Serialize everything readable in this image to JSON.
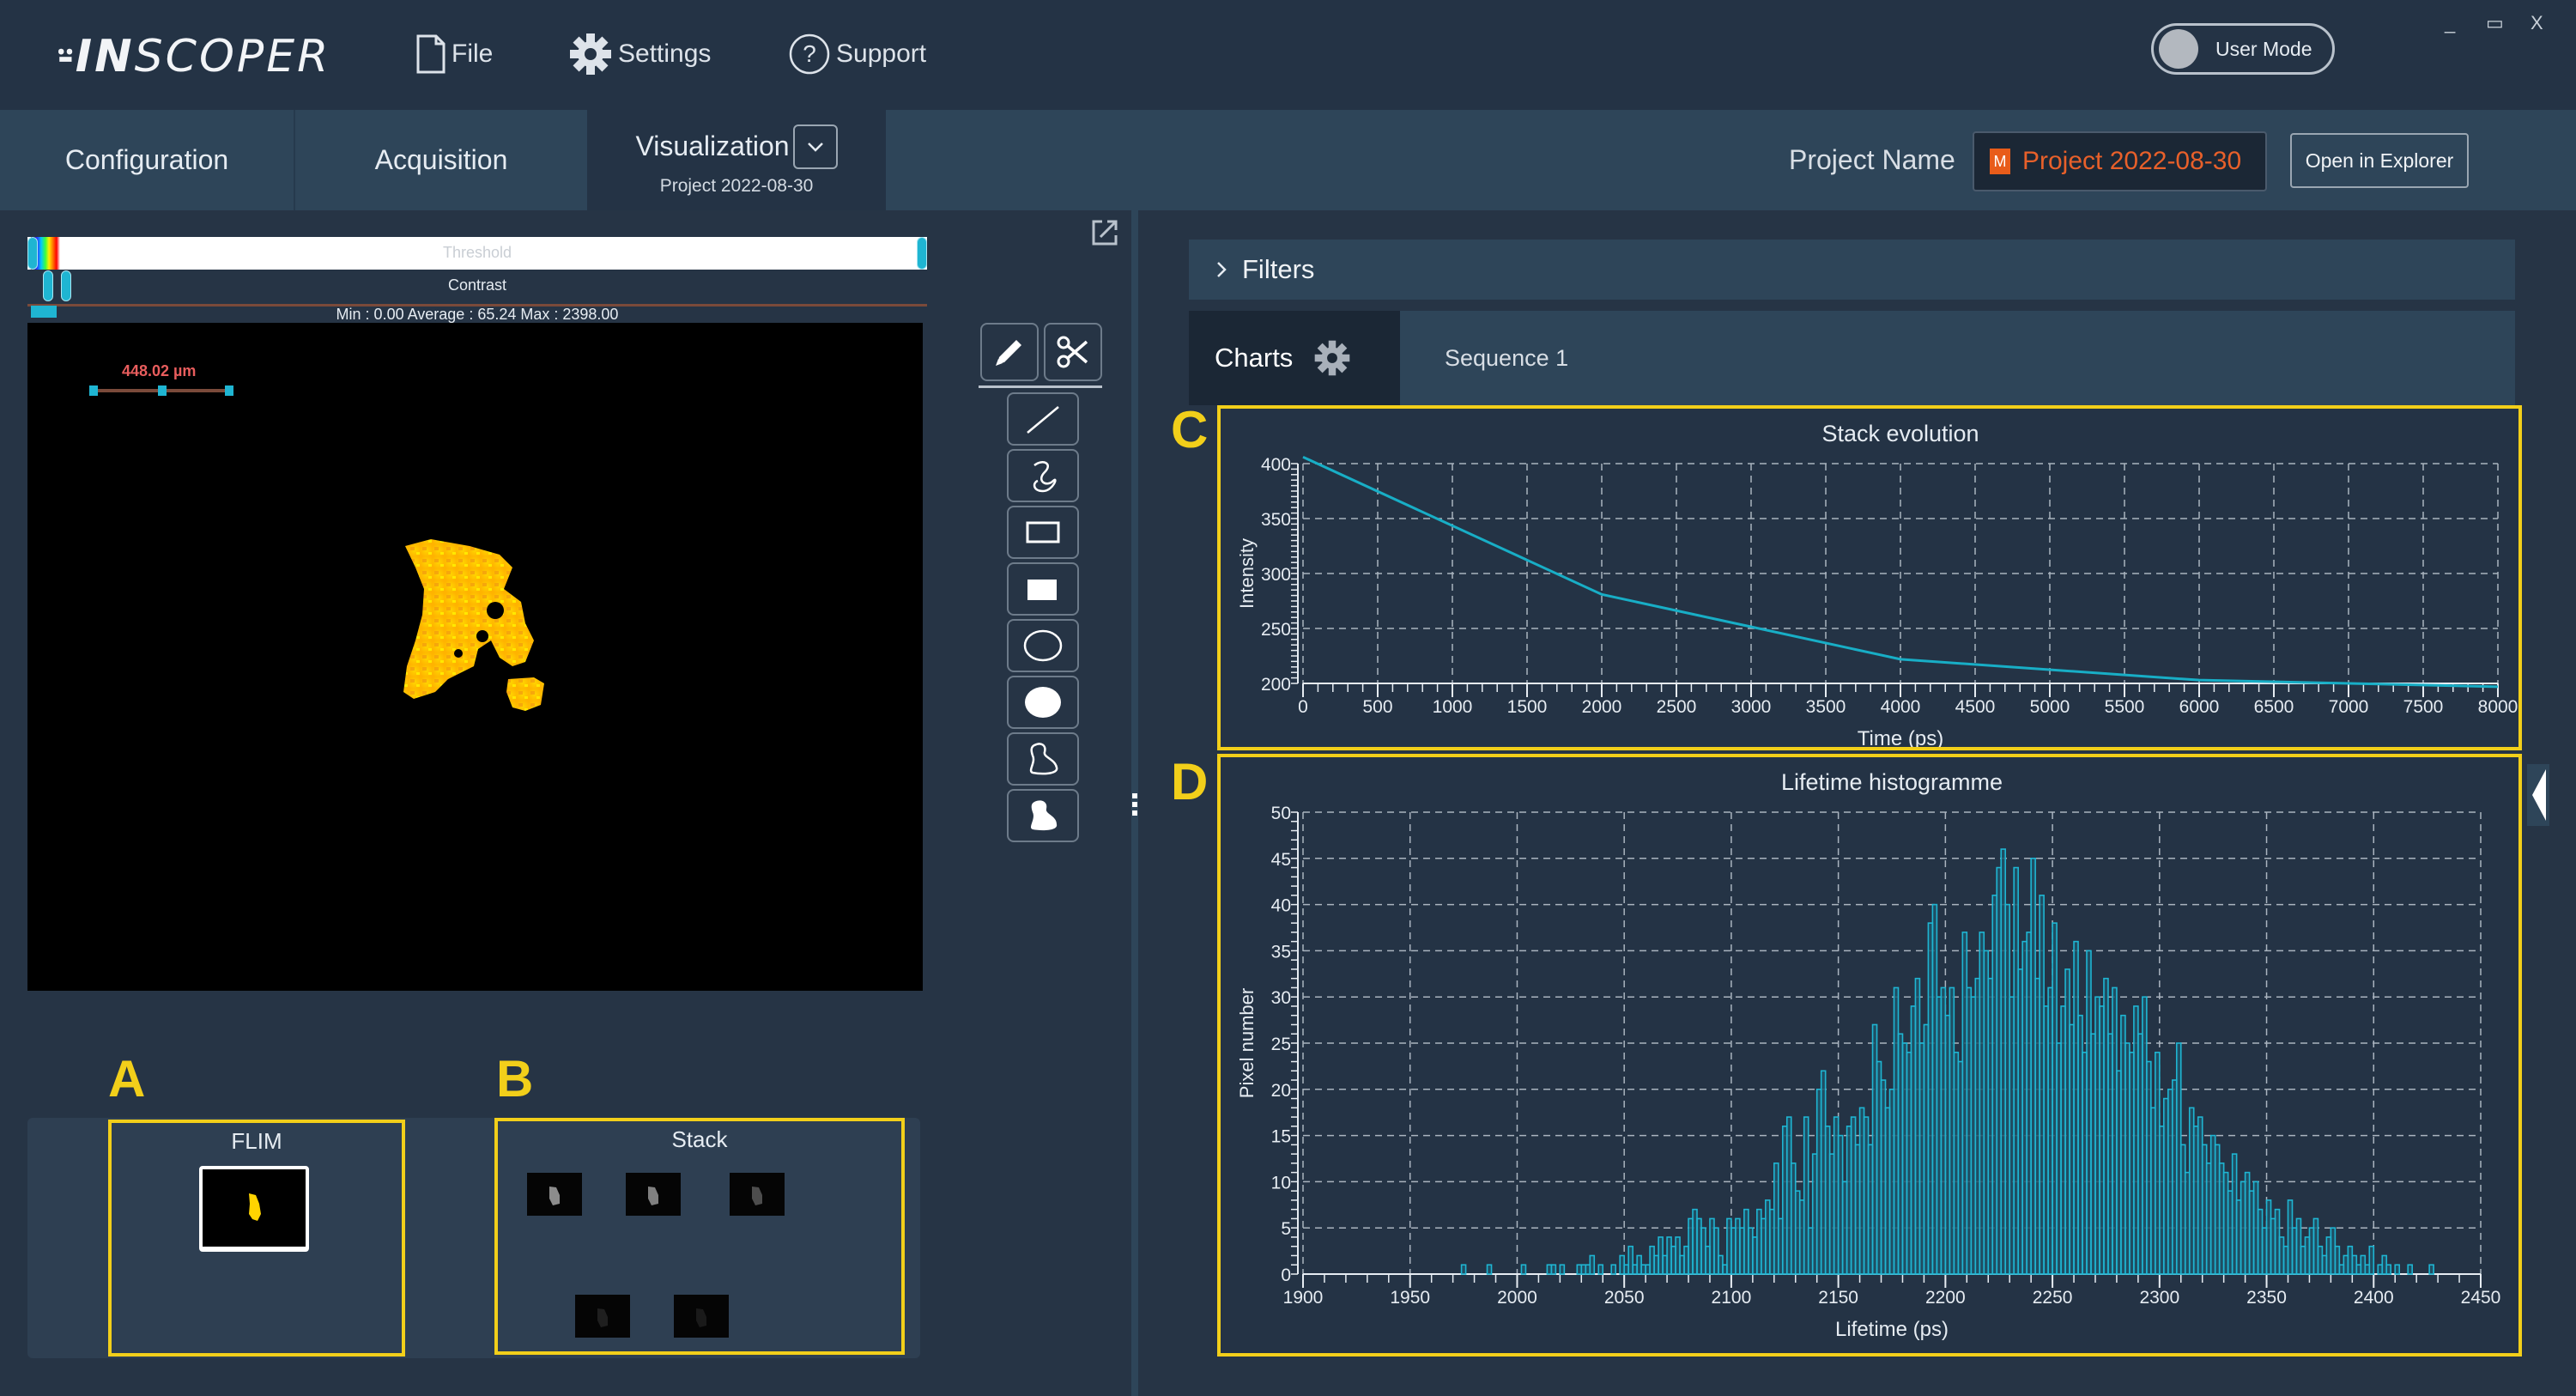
{
  "app": {
    "logo_prefix": "IN",
    "logo_suffix": "SCOPER",
    "menu": [
      {
        "icon": "file-icon",
        "label": "File"
      },
      {
        "icon": "gear-icon",
        "label": "Settings"
      },
      {
        "icon": "help-icon",
        "label": "Support"
      }
    ],
    "user_mode_label": "User Mode",
    "window_controls": {
      "minimize": "_",
      "maximize": "▭",
      "close": "X"
    }
  },
  "tabs": [
    {
      "label": "Configuration"
    },
    {
      "label": "Acquisition"
    },
    {
      "label": "Visualization",
      "sub": "Project 2022-08-30",
      "active": true
    }
  ],
  "project": {
    "label": "Project Name",
    "badge": "M",
    "value": "Project 2022-08-30",
    "open_button": "Open in Explorer"
  },
  "viewer": {
    "threshold_label": "Threshold",
    "contrast_label": "Contrast",
    "stats": "Min : 0.00 Average : 65.24 Max : 2398.00",
    "scale_bar": "448.02 µm"
  },
  "tools": [
    {
      "name": "pencil-icon"
    },
    {
      "name": "scissors-icon"
    },
    {
      "name": "line-tool-icon"
    },
    {
      "name": "freehand-tool-icon"
    },
    {
      "name": "rectangle-outline-icon"
    },
    {
      "name": "rectangle-filled-icon"
    },
    {
      "name": "ellipse-outline-icon"
    },
    {
      "name": "ellipse-filled-icon"
    },
    {
      "name": "polygon-outline-icon"
    },
    {
      "name": "polygon-filled-icon"
    }
  ],
  "thumbnails": {
    "a_letter": "A",
    "b_letter": "B",
    "flim_title": "FLIM",
    "stack_title": "Stack",
    "stack_brightness": [
      0.55,
      0.5,
      0.3,
      0.12,
      0.1
    ]
  },
  "right": {
    "filters_label": "Filters",
    "charts_tab": "Charts",
    "sequence_tab": "Sequence 1",
    "c_letter": "C",
    "d_letter": "D"
  },
  "colors": {
    "accent": "#1fb5d2",
    "highlight": "#f2cf1a",
    "project_text": "#e8602a",
    "background": "#263445"
  },
  "chart_data": [
    {
      "type": "line",
      "title": "Stack evolution",
      "xlabel": "Time (ps)",
      "ylabel": "Intensity",
      "xlim": [
        0,
        8000
      ],
      "ylim": [
        200,
        400
      ],
      "xticks": [
        0,
        500,
        1000,
        1500,
        2000,
        2500,
        3000,
        3500,
        4000,
        4500,
        5000,
        5500,
        6000,
        6500,
        7000,
        7500,
        8000
      ],
      "yticks": [
        200,
        250,
        300,
        350,
        400
      ],
      "grid": true,
      "series": [
        {
          "name": "Intensity",
          "x": [
            0,
            2000,
            4000,
            6000,
            8000
          ],
          "y": [
            406,
            281,
            222,
            203,
            197
          ]
        }
      ]
    },
    {
      "type": "area",
      "title": "Lifetime histogramme",
      "xlabel": "Lifetime (ps)",
      "ylabel": "Pixel number",
      "xlim": [
        1900,
        2450
      ],
      "ylim": [
        0,
        50
      ],
      "xticks": [
        1900,
        1950,
        2000,
        2050,
        2100,
        2150,
        2200,
        2250,
        2300,
        2350,
        2400,
        2450
      ],
      "yticks": [
        0,
        5,
        10,
        15,
        20,
        25,
        30,
        35,
        40,
        45,
        50
      ],
      "grid": true,
      "bin_start": 1930,
      "bin_width": 2,
      "series": [
        {
          "name": "Pixel number",
          "values": [
            0,
            0,
            0,
            0,
            0,
            0,
            0,
            0,
            0,
            0,
            0,
            0,
            0,
            0,
            0,
            0,
            0,
            0,
            0,
            0,
            0,
            0,
            1,
            0,
            0,
            0,
            0,
            0,
            1,
            0,
            0,
            0,
            0,
            0,
            0,
            0,
            1,
            0,
            0,
            0,
            0,
            0,
            1,
            1,
            0,
            1,
            0,
            0,
            0,
            1,
            1,
            1,
            2,
            0,
            1,
            0,
            0,
            1,
            0,
            2,
            1,
            3,
            1,
            2,
            1,
            1,
            3,
            2,
            4,
            2,
            4,
            3,
            4,
            2,
            3,
            6,
            7,
            6,
            5,
            3,
            6,
            5,
            2,
            1,
            6,
            5,
            6,
            5,
            7,
            5,
            4,
            7,
            6,
            8,
            7,
            12,
            6,
            16,
            17,
            12,
            9,
            8,
            17,
            5,
            13,
            20,
            22,
            16,
            13,
            17,
            15,
            10,
            16,
            17,
            14,
            18,
            17,
            14,
            27,
            23,
            21,
            18,
            20,
            31,
            26,
            25,
            24,
            29,
            32,
            25,
            27,
            38,
            40,
            30,
            31,
            28,
            31,
            24,
            23,
            37,
            31,
            30,
            32,
            37,
            35,
            32,
            41,
            44,
            46,
            40,
            30,
            44,
            33,
            36,
            37,
            45,
            32,
            41,
            29,
            31,
            38,
            25,
            29,
            33,
            27,
            36,
            28,
            24,
            35,
            26,
            30,
            29,
            32,
            26,
            31,
            22,
            28,
            25,
            24,
            29,
            26,
            30,
            23,
            18,
            24,
            16,
            19,
            20,
            21,
            25,
            14,
            11,
            18,
            16,
            17,
            14,
            12,
            15,
            14,
            12,
            11,
            9,
            13,
            8,
            10,
            11,
            9,
            10,
            7,
            5,
            8,
            6,
            7,
            4,
            3,
            8,
            5,
            6,
            3,
            4,
            5,
            6,
            3,
            2,
            4,
            5,
            3,
            1,
            2,
            3,
            2,
            1,
            2,
            1,
            3,
            0,
            1,
            2,
            1,
            0,
            1,
            0,
            0,
            1,
            0,
            0,
            0,
            0,
            1,
            0,
            0,
            0,
            0,
            0,
            0,
            0,
            0,
            0,
            0,
            0,
            0,
            0,
            0,
            0,
            0,
            0,
            0,
            0,
            0,
            0,
            0,
            0,
            0
          ]
        }
      ]
    }
  ]
}
